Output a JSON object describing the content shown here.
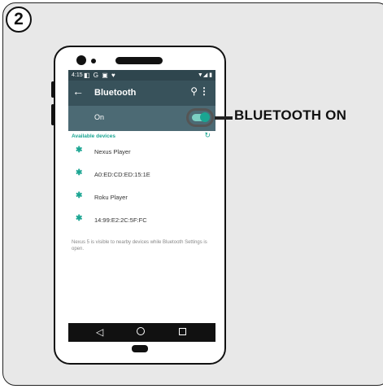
{
  "step_number": "2",
  "callout_text": "BLUETOOTH ON",
  "status_bar": {
    "time": "4:15",
    "notification_icons": "◧ G ▣ ♥",
    "system_icons": "▼◢ ▮"
  },
  "app_bar": {
    "back_icon": "←",
    "title": "Bluetooth",
    "search_icon": "⚲",
    "more_icon": "⋮"
  },
  "toggle": {
    "label": "On",
    "state": "on"
  },
  "section_header": "Available devices",
  "refresh_icon": "↻",
  "devices": [
    {
      "name": "Nexus Player"
    },
    {
      "name": "A0:ED:CD:ED:15:1E"
    },
    {
      "name": "Roku Player"
    },
    {
      "name": "14:99:E2:2C:5F:FC"
    }
  ],
  "bluetooth_icon": "✱",
  "visibility_note": "Nexus 5 is visible to nearby devices while Bluetooth Settings is open.",
  "nav": {
    "back_icon": "◁"
  },
  "colors": {
    "status_bar": "#2f464e",
    "app_bar": "#38525b",
    "on_bar": "#4c6a74",
    "accent": "#1aa592"
  }
}
